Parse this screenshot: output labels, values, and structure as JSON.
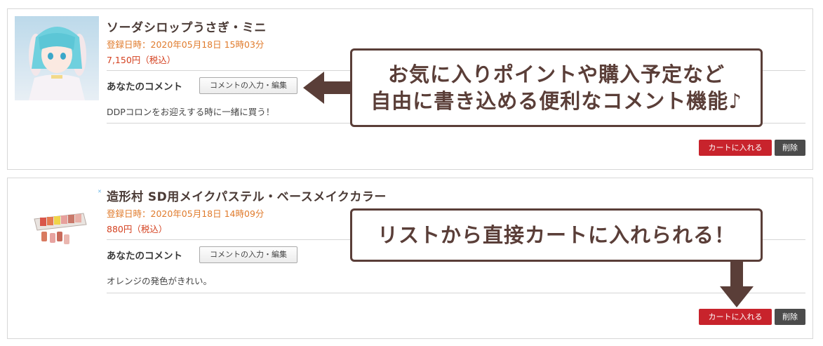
{
  "items": [
    {
      "title": "ソーダシロップうさぎ・ミニ",
      "date": "登録日時：2020年05月18日 15時03分",
      "price": "7,150円（税込）",
      "comment_label": "あなたのコメント",
      "comment_button": "コメントの入力・編集",
      "comment_text": "DDPコロンをお迎えする時に一緒に買う！",
      "cart_button": "カートに入れる",
      "delete_button": "削除"
    },
    {
      "title": "造形村 SD用メイクパステル・ベースメイクカラー",
      "date": "登録日時：2020年05月18日 14時09分",
      "price": "880円（税込）",
      "comment_label": "あなたのコメント",
      "comment_button": "コメントの入力・編集",
      "comment_text": "オレンジの発色がきれい。",
      "cart_button": "カートに入れる",
      "delete_button": "削除"
    }
  ],
  "callouts": {
    "comment_line1": "お気に入りポイントや購入予定など",
    "comment_line2": "自由に書き込める便利なコメント機能♪",
    "cart": "リストから直接カートに入れられる！"
  },
  "colors": {
    "accent_brown": "#5a3e38",
    "cart_red": "#c8232c",
    "date_orange": "#e07b2c",
    "price_red": "#d4401f",
    "delete_gray": "#4b4b4b"
  },
  "icons": [
    "doll-product-image",
    "pastel-product-image",
    "left-arrow-icon",
    "down-arrow-icon"
  ]
}
